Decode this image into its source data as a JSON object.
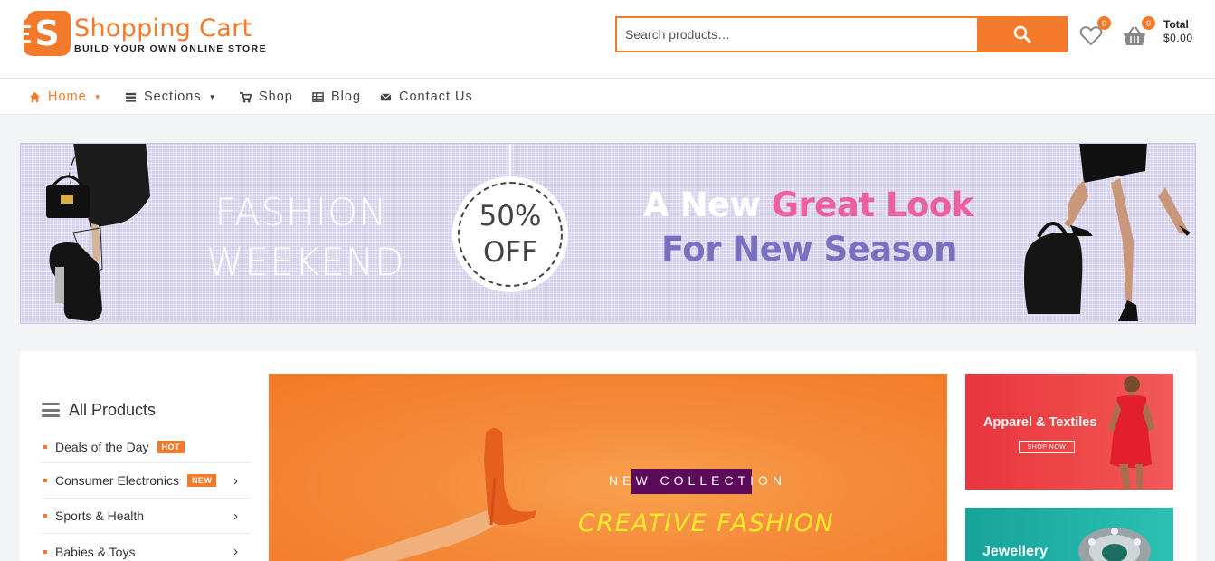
{
  "brand": {
    "logo_letter": "S",
    "title": "Shopping Cart",
    "subtitle": "BUILD YOUR OWN ONLINE STORE"
  },
  "search": {
    "placeholder": "Search products…"
  },
  "wishlist": {
    "count": "0"
  },
  "cart": {
    "count": "0",
    "total_label": "Total",
    "total_value": "$0.00"
  },
  "nav": {
    "items": [
      {
        "label": "Home",
        "icon": "home-icon",
        "dropdown": true,
        "active": true
      },
      {
        "label": "Sections",
        "icon": "sections-icon",
        "dropdown": true,
        "active": false
      },
      {
        "label": "Shop",
        "icon": "cart-icon",
        "dropdown": false,
        "active": false
      },
      {
        "label": "Blog",
        "icon": "blog-icon",
        "dropdown": false,
        "active": false
      },
      {
        "label": "Contact Us",
        "icon": "mail-icon",
        "dropdown": false,
        "active": false
      }
    ]
  },
  "banner": {
    "line1": "FASHION",
    "line2": "WEEKEND",
    "discount_value": "50%",
    "discount_label": "OFF",
    "headline_white": "A New ",
    "headline_pink": "Great Look",
    "headline_line2": "For New Season"
  },
  "sidebar": {
    "title": "All Products",
    "items": [
      {
        "label": "Deals of the Day",
        "tag": "HOT",
        "arrow": false
      },
      {
        "label": "Consumer Electronics",
        "tag": "NEW",
        "arrow": true
      },
      {
        "label": "Sports & Health",
        "tag": "",
        "arrow": true
      },
      {
        "label": "Babies & Toys",
        "tag": "",
        "arrow": true
      }
    ]
  },
  "slider": {
    "kicker": "NEW COLLECTION",
    "headline": "CREATIVE FASHION"
  },
  "promos": [
    {
      "title": "Apparel & Textiles",
      "button": "SHOP NOW"
    },
    {
      "title": "Jewellery"
    }
  ],
  "colors": {
    "accent": "#f47a2b",
    "banner_bg": "#d7d2ec",
    "banner_pink": "#ec5fa0",
    "banner_purple": "#7b70c0",
    "slider_highlight": "#5c0a5a",
    "slider_headline": "#f7ea2a",
    "promo_red": "#e9353e",
    "promo_teal": "#17a39a"
  }
}
